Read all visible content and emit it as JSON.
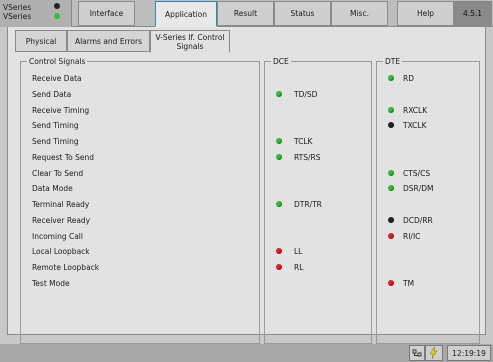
{
  "header": {
    "brand_line1": "VSeries",
    "brand_line2": "VSeries",
    "brand_led_color": "#2fbf2f",
    "tabs": [
      {
        "label": "Interface"
      },
      {
        "label": "Application"
      },
      {
        "label": "Result"
      },
      {
        "label": "Status"
      },
      {
        "label": "Misc."
      },
      {
        "label": "Help"
      }
    ],
    "active_tab": "Application",
    "version": "4.5.1"
  },
  "subtabs": [
    {
      "label": "Physical"
    },
    {
      "label": "Alarms and Errors"
    },
    {
      "label": "V-Series If. Control Signals"
    }
  ],
  "active_subtab": "V-Series If. Control Signals",
  "control_signals": {
    "title": "Control Signals",
    "items": [
      "Receive Data",
      "Send Data",
      "Receive Timing",
      "Send Timing",
      "Send Timing",
      "Request To Send",
      "Clear To Send",
      "Data Mode",
      "Terminal Ready",
      "Receiver Ready",
      "Incoming Call",
      "Local Loopback",
      "Remote Loopback",
      "Test Mode"
    ]
  },
  "dce": {
    "title": "DCE",
    "signals": [
      {
        "row": 1,
        "label": "TD/SD",
        "status": "green"
      },
      {
        "row": 4,
        "label": "TCLK",
        "status": "green"
      },
      {
        "row": 5,
        "label": "RTS/RS",
        "status": "green"
      },
      {
        "row": 8,
        "label": "DTR/TR",
        "status": "green"
      },
      {
        "row": 11,
        "label": "LL",
        "status": "red"
      },
      {
        "row": 12,
        "label": "RL",
        "status": "red"
      }
    ]
  },
  "dte": {
    "title": "DTE",
    "signals": [
      {
        "row": 0,
        "label": "RD",
        "status": "green"
      },
      {
        "row": 2,
        "label": "RXCLK",
        "status": "green"
      },
      {
        "row": 3,
        "label": "TXCLK",
        "status": "black"
      },
      {
        "row": 6,
        "label": "CTS/CS",
        "status": "green"
      },
      {
        "row": 7,
        "label": "DSR/DM",
        "status": "green"
      },
      {
        "row": 9,
        "label": "DCD/RR",
        "status": "black"
      },
      {
        "row": 10,
        "label": "RI/IC",
        "status": "red"
      },
      {
        "row": 13,
        "label": "TM",
        "status": "red"
      }
    ]
  },
  "status_colors": {
    "green": "#2fbf2f",
    "red": "#e02020",
    "black": "#222222"
  },
  "footer": {
    "icons": [
      "network-icon",
      "power-icon"
    ],
    "time": "12:19:19"
  }
}
